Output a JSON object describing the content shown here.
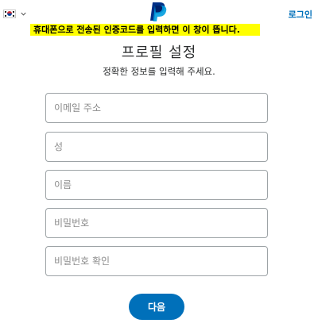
{
  "header": {
    "country_flag_icon": "south-korea-flag-icon",
    "dropdown_icon": "chevron-down-icon",
    "logo_icon": "paypal-logo-icon",
    "login_label": "로그인"
  },
  "notice": {
    "text": "휴대폰으로 전송된 인증코드를 입력하면 이 창이 뜹니다.",
    "highlight_color": "#ffff00"
  },
  "page": {
    "title": "프로필 설정",
    "subtitle": "정확한 정보를 입력해 주세요."
  },
  "form": {
    "email": {
      "placeholder": "이메일 주소",
      "value": ""
    },
    "last_name": {
      "placeholder": "성",
      "value": ""
    },
    "first_name": {
      "placeholder": "이름",
      "value": ""
    },
    "password": {
      "placeholder": "비밀번호",
      "value": ""
    },
    "confirm_password": {
      "placeholder": "비밀번호 확인",
      "value": ""
    },
    "next_label": "다음"
  },
  "colors": {
    "brand_blue": "#0070ba",
    "logo_dark_blue": "#003087",
    "logo_light_blue": "#009cde",
    "text": "#2c2e2f",
    "field_border": "#9da3a6"
  }
}
